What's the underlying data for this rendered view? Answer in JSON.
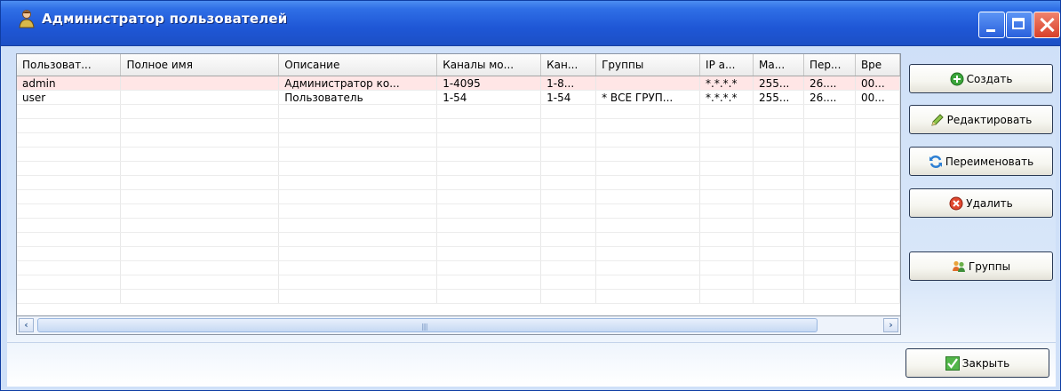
{
  "window": {
    "title": "Администратор пользователей",
    "accent": "#2a62dd"
  },
  "table": {
    "columns": [
      "Пользоват...",
      "Полное имя",
      "Описание",
      "Каналы мо...",
      "Кан...",
      "Группы",
      "IP а...",
      "Ма...",
      "Пер...",
      "Вре"
    ],
    "rows": [
      [
        "admin",
        "",
        "Администратор ко...",
        "1-4095",
        "1-8...",
        "",
        "*.*.*.*",
        "255...",
        "26....",
        "00..."
      ],
      [
        "user",
        "",
        "Пользователь",
        "1-54",
        "1-54",
        "* ВСЕ ГРУП...",
        "*.*.*.*",
        "255...",
        "26....",
        "00..."
      ]
    ],
    "selected_row": 0
  },
  "buttons": {
    "create": "Создать",
    "edit": "Редактировать",
    "rename": "Переименовать",
    "delete": "Удалить",
    "groups": "Группы",
    "close": "Закрыть"
  },
  "icons": {
    "app": "users-icon",
    "create": "plus-green-icon",
    "edit": "pencil-icon",
    "rename": "refresh-icon",
    "delete": "delete-red-icon",
    "groups": "group-icon",
    "close": "checkmark-icon"
  }
}
